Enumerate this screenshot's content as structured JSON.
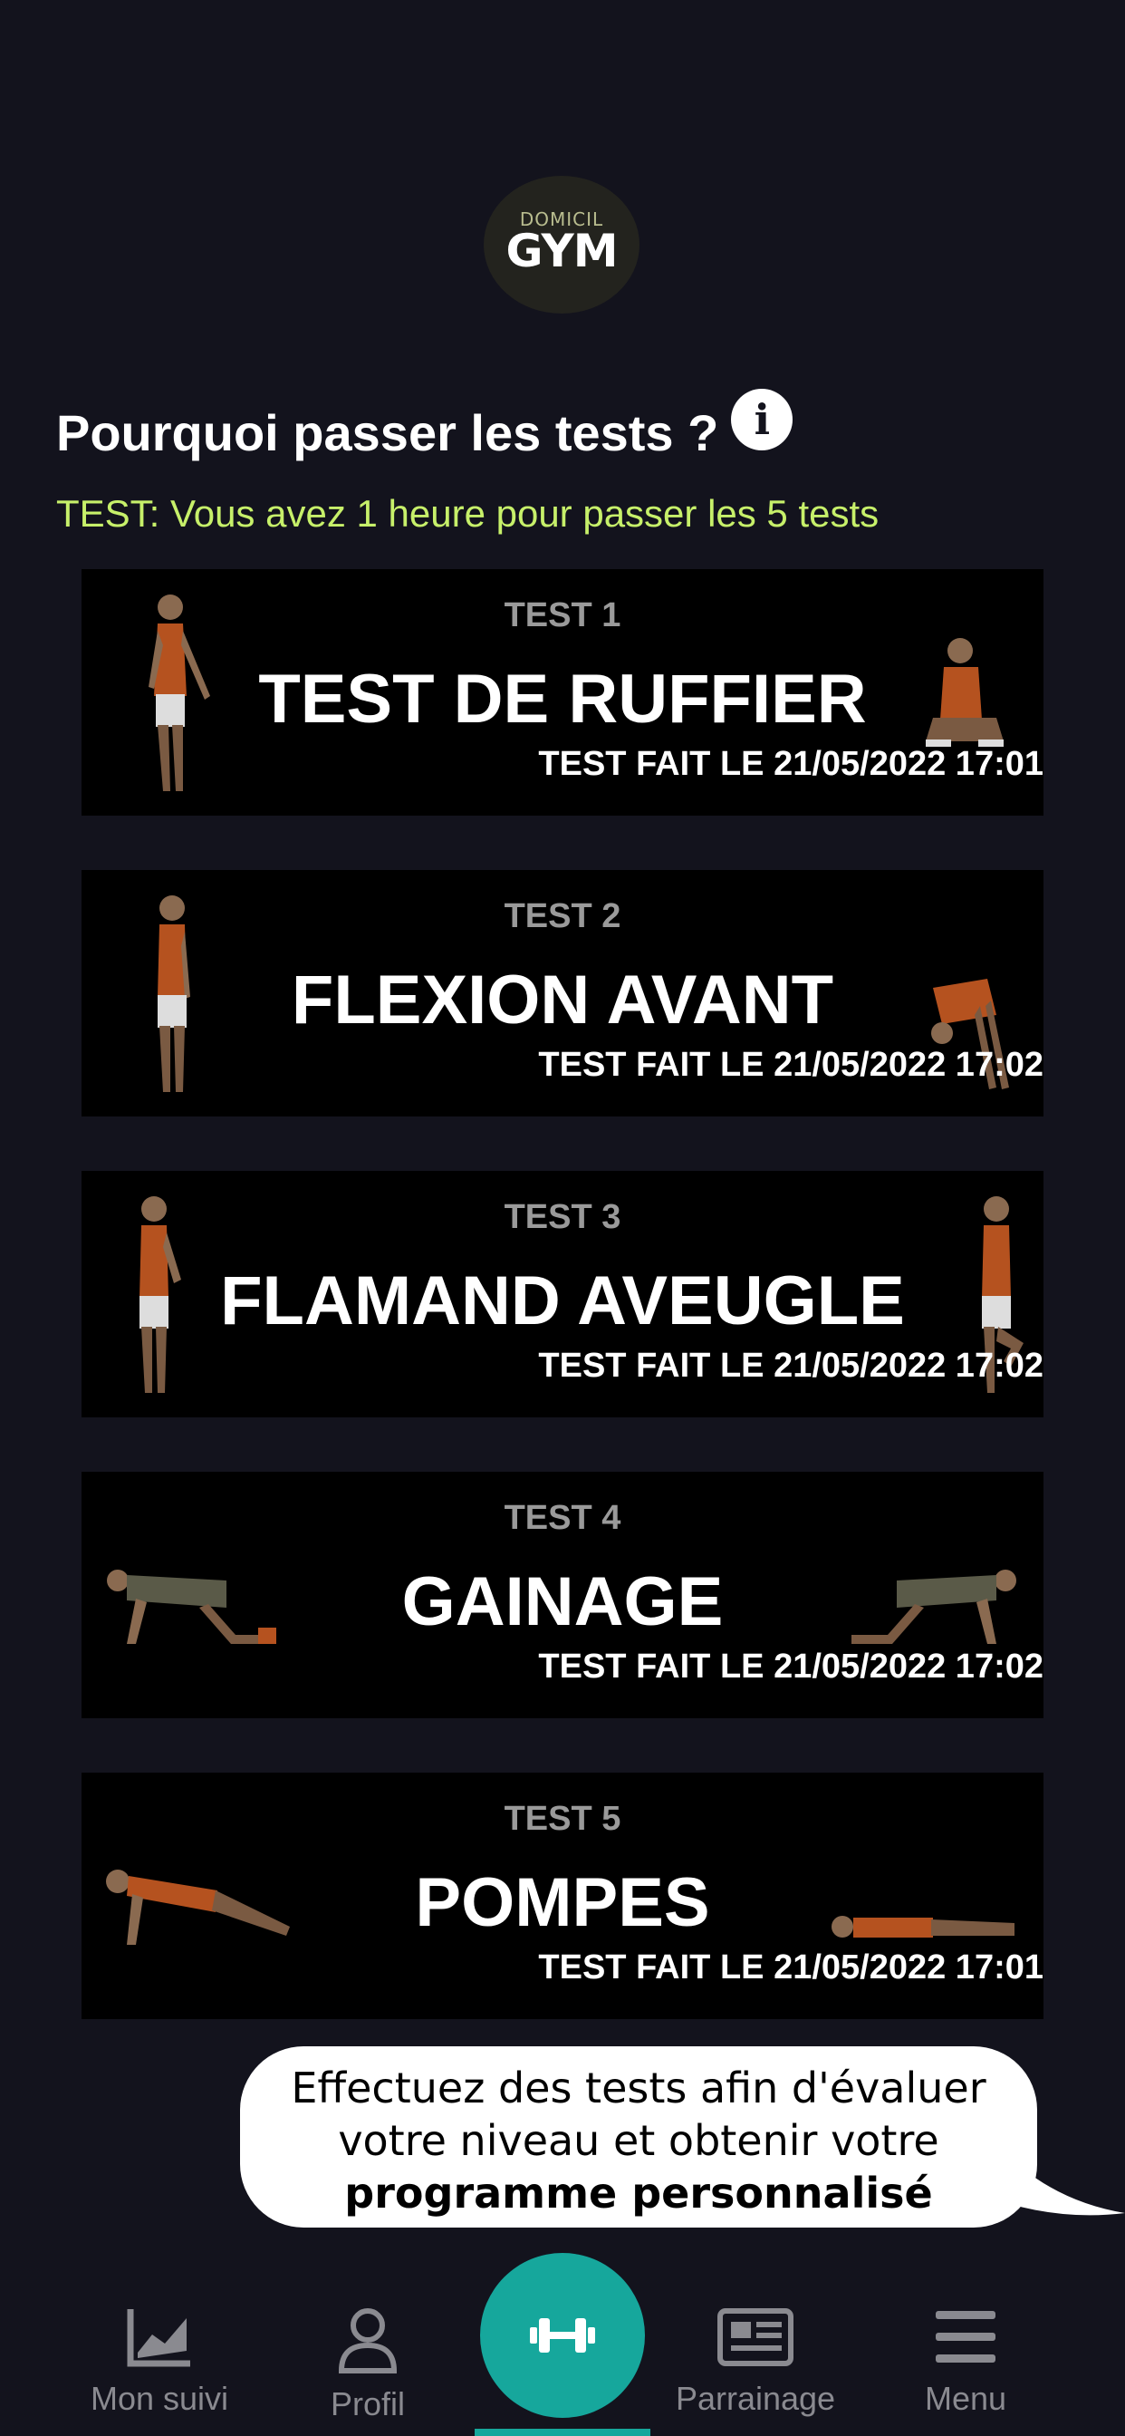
{
  "logo": {
    "small": "DOMICIL",
    "big": "GYM"
  },
  "heading": "Pourquoi passer les tests ?",
  "timer_note": "TEST: Vous avez 1 heure pour passer les 5 tests",
  "tests": [
    {
      "num": "TEST 1",
      "title": "TEST DE RUFFIER",
      "date": "TEST FAIT LE 21/05/2022 17:01"
    },
    {
      "num": "TEST 2",
      "title": "FLEXION AVANT",
      "date": "TEST FAIT LE 21/05/2022 17:02"
    },
    {
      "num": "TEST 3",
      "title": "FLAMAND AVEUGLE",
      "date": "TEST FAIT LE 21/05/2022 17:02"
    },
    {
      "num": "TEST 4",
      "title": "GAINAGE",
      "date": "TEST FAIT LE 21/05/2022 17:02"
    },
    {
      "num": "TEST 5",
      "title": "POMPES",
      "date": "TEST FAIT LE 21/05/2022 17:01"
    }
  ],
  "bubble": {
    "line1": "Effectuez des tests afin d'évaluer",
    "line2": "votre niveau et obtenir votre",
    "line3": "programme personnalisé"
  },
  "nav": {
    "suivi": "Mon suivi",
    "profil": "Profil",
    "parrainage": "Parrainage",
    "menu": "Menu"
  },
  "colors": {
    "background": "#13131d",
    "accent": "#16a79c",
    "note": "#c7f06a"
  }
}
